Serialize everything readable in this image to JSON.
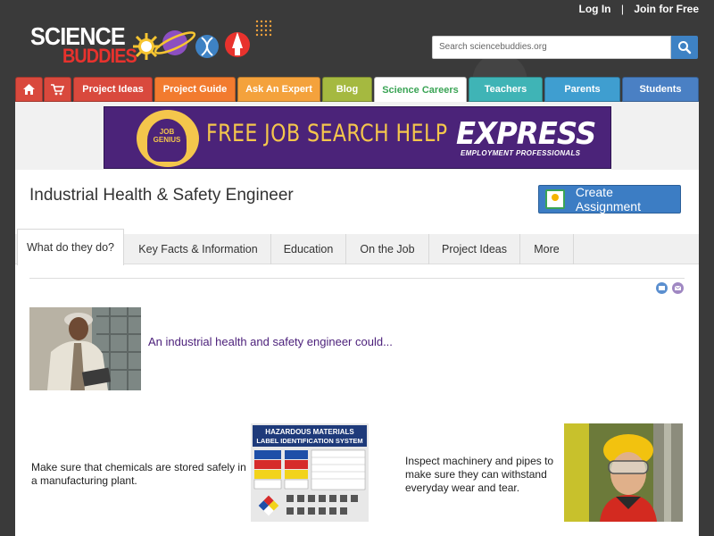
{
  "header": {
    "logo_line1": "SCIENCE",
    "logo_line2": "BUDDIES",
    "login": "Log In",
    "separator": "|",
    "join": "Join for Free",
    "search_placeholder": "Search sciencebuddies.org"
  },
  "nav": {
    "home_icon": "home-icon",
    "cart_icon": "cart-icon",
    "tabs": [
      {
        "label": "Project Ideas",
        "color": "#d9493d"
      },
      {
        "label": "Project Guide",
        "color": "#f27b2f"
      },
      {
        "label": "Ask An Expert",
        "color": "#f4a23c"
      },
      {
        "label": "Blog",
        "color": "#a5b940"
      },
      {
        "label": "Science Careers",
        "color": "#ffffff"
      },
      {
        "label": "Teachers",
        "color": "#3fb4b6"
      },
      {
        "label": "Parents",
        "color": "#3f9ed0"
      },
      {
        "label": "Students",
        "color": "#4a80c4"
      }
    ],
    "active_text_color": "#3aa455"
  },
  "banner": {
    "badge_line1": "JOB",
    "badge_line2": "GENIUS",
    "headline": "FREE JOB SEARCH HELP",
    "brand": "EXPRESS",
    "brand_sub": "EMPLOYMENT PROFESSIONALS"
  },
  "page": {
    "title": "Industrial Health & Safety Engineer",
    "create_assignment": "Create Assignment"
  },
  "tabs": [
    {
      "label": "What do they do?",
      "active": true
    },
    {
      "label": "Key Facts & Information",
      "active": false
    },
    {
      "label": "Education",
      "active": false
    },
    {
      "label": "On the Job",
      "active": false
    },
    {
      "label": "Project Ideas",
      "active": false
    },
    {
      "label": "More",
      "active": false
    }
  ],
  "actions": {
    "print_icon": "print-icon",
    "email_icon": "email-icon"
  },
  "intro": {
    "text": "An industrial health and safety engineer could..."
  },
  "tasks": [
    {
      "text": "Make sure that chemicals are stored safely in a manufacturing plant."
    },
    {
      "text": "Inspect machinery and pipes to make sure they can withstand everyday wear and tear."
    }
  ],
  "hazmat_sign": {
    "title_line1": "HAZARDOUS MATERIALS",
    "title_line2": "LABEL IDENTIFICATION SYSTEM"
  }
}
